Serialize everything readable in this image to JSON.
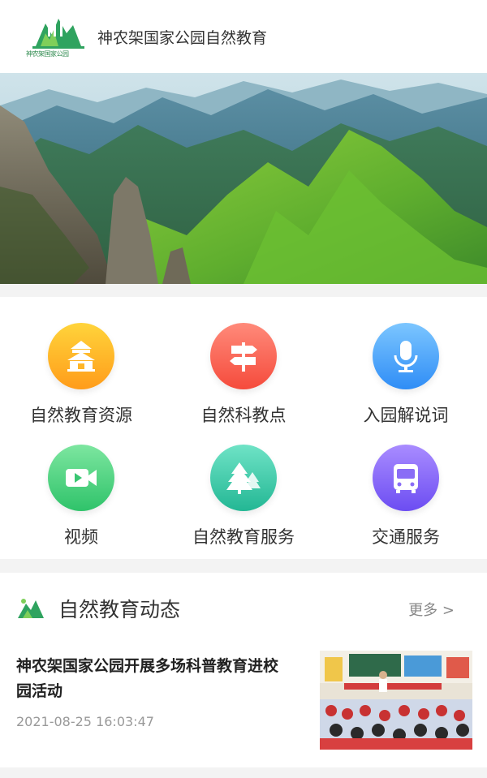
{
  "header": {
    "app_title": "神农架国家公园自然教育",
    "logo_text": "神农架国家公园"
  },
  "banner": {
    "image": "mountain-landscape"
  },
  "features": [
    {
      "label": "自然教育资源",
      "icon": "temple-icon",
      "color_top": "#ffd43b",
      "color_bottom": "#ff9c1a"
    },
    {
      "label": "自然科教点",
      "icon": "signpost-icon",
      "color_top": "#ff8a7a",
      "color_bottom": "#f54b3c"
    },
    {
      "label": "入园解说词",
      "icon": "microphone-icon",
      "color_top": "#7cc6ff",
      "color_bottom": "#2f8df6"
    },
    {
      "label": "视频",
      "icon": "video-camera-icon",
      "color_top": "#7de6a0",
      "color_bottom": "#2fc36a"
    },
    {
      "label": "自然教育服务",
      "icon": "pine-tree-icon",
      "color_top": "#6fe3c6",
      "color_bottom": "#23b794"
    },
    {
      "label": "交通服务",
      "icon": "bus-icon",
      "color_top": "#a98cff",
      "color_bottom": "#6c4df2"
    }
  ],
  "news": {
    "section_title": "自然教育动态",
    "more_label": "更多 >",
    "items": [
      {
        "title": "神农架国家公园开展多场科普教育进校园活动",
        "date": "2021-08-25 16:03:47"
      }
    ]
  }
}
